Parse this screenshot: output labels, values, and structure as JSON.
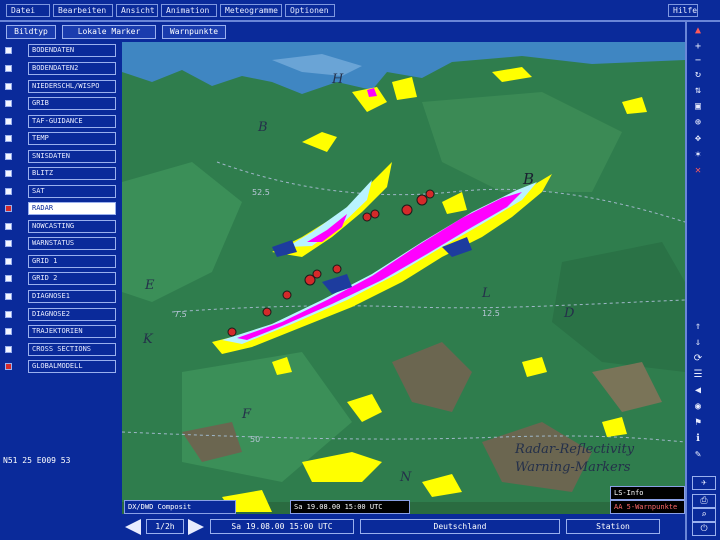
{
  "menubar": {
    "items": [
      "Datei",
      "Bearbeiten",
      "Ansicht",
      "Animation",
      "Meteogramme",
      "Optionen"
    ],
    "help": "Hilfe"
  },
  "toolbar": {
    "buttons": [
      "Bildtyp",
      "Lokale Marker",
      "Warnpunkte"
    ]
  },
  "layers": [
    {
      "label": "BODENDATEN",
      "checked": false
    },
    {
      "label": "BODENDATEN2",
      "checked": false
    },
    {
      "label": "NIEDERSCHL/WISPO",
      "checked": false
    },
    {
      "label": "GRIB",
      "checked": false
    },
    {
      "label": "TAF-GUIDANCE",
      "checked": false
    },
    {
      "label": "TEMP",
      "checked": false
    },
    {
      "label": "SNISDATEN",
      "checked": false
    },
    {
      "label": "BLITZ",
      "checked": false
    },
    {
      "label": "SAT",
      "checked": false
    },
    {
      "label": "RADAR",
      "checked": true,
      "active": true
    },
    {
      "label": "NOWCASTING",
      "checked": false
    },
    {
      "label": "WARNSTATUS",
      "checked": false
    },
    {
      "label": "GRID 1",
      "checked": false
    },
    {
      "label": "GRID 2",
      "checked": false
    },
    {
      "label": "DIAGNOSE1",
      "checked": false
    },
    {
      "label": "DIAGNOSE2",
      "checked": false
    },
    {
      "label": "TRAJEKTORIEN",
      "checked": false
    },
    {
      "label": "CROSS SECTIONS",
      "checked": false
    },
    {
      "label": "GLOBALMODELL",
      "checked": true
    }
  ],
  "coords": "N51 25 E009 53",
  "map": {
    "labels": [
      "H",
      "B",
      "B",
      "E",
      "L",
      "D",
      "K",
      "F",
      "N"
    ],
    "isolines": [
      "52.5",
      "7.5",
      "12.5",
      "50"
    ],
    "caption_line1": "Radar-Reflectivity",
    "caption_line2": "Warning-Markers"
  },
  "legend": {
    "left": "DX/DWD Composit",
    "middle": "Sa 19.08.00 15:00 UTC",
    "right_top": "LS-Info",
    "right_bottom": "AA 5-Warnpunkte"
  },
  "bottombar": {
    "step": "1/2h",
    "time": "Sa 19.08.00 15:00 UTC",
    "region": "Deutschland",
    "mode": "Station"
  },
  "colors": {
    "ui_blue": "#0a2a9a",
    "land_green": "#2f7d4d",
    "radar_yellow": "#ffff00",
    "radar_magenta": "#ff00ff",
    "marker_red": "#d42a2a"
  }
}
